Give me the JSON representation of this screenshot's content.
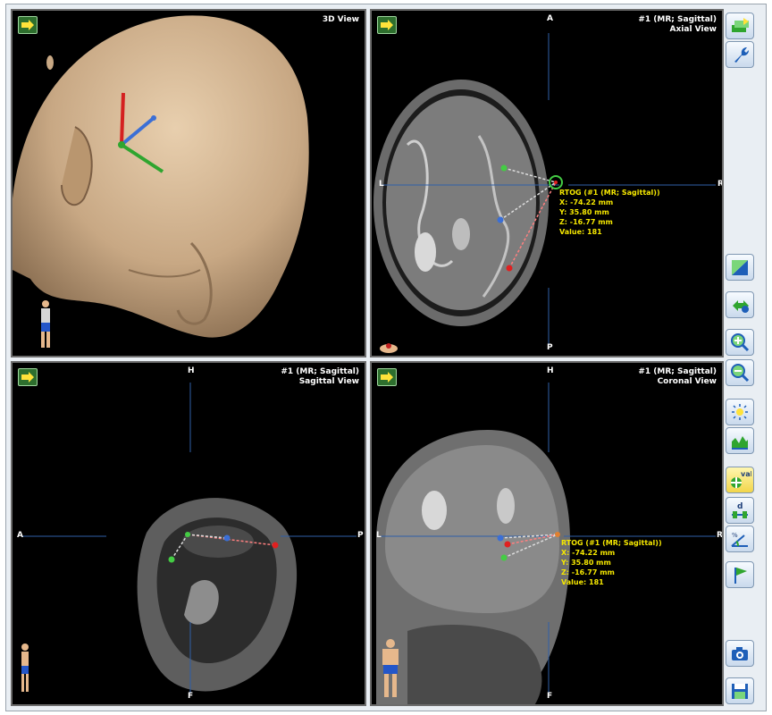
{
  "views": {
    "view3d": {
      "title": "3D View"
    },
    "axial": {
      "series": "#1 (MR; Sagittal)",
      "title": "Axial View",
      "dirs": {
        "top": "A",
        "bottom": "P",
        "left": "L",
        "right": "R"
      }
    },
    "sagittal": {
      "series": "#1 (MR; Sagittal)",
      "title": "Sagittal View",
      "dirs": {
        "top": "H",
        "bottom": "F",
        "left": "A",
        "right": "P"
      }
    },
    "coronal": {
      "series": "#1 (MR; Sagittal)",
      "title": "Coronal View",
      "dirs": {
        "top": "H",
        "bottom": "F",
        "left": "L",
        "right": "R"
      }
    }
  },
  "readout": {
    "name": "RTOG (#1 (MR; Sagittal))",
    "x": "X: -74.22 mm",
    "y": "Y: 35.80 mm",
    "z": "Z: -16.77 mm",
    "value": "Value: 181"
  },
  "toolbar": {
    "icons": [
      "layers-icon",
      "wrench-icon",
      "contrast-icon",
      "pan-icon",
      "zoom-in-icon",
      "zoom-out-icon",
      "brightness-icon",
      "histogram-icon",
      "value-probe-icon",
      "distance-measure-icon",
      "angle-measure-icon",
      "flag-icon",
      "camera-icon",
      "save-icon"
    ],
    "value_probe_label": "val",
    "distance_label": "d"
  },
  "colors": {
    "readout_text": "#f5e700",
    "axis_line": "#2f5fa8",
    "viewport_bg": "#000000",
    "toolbar_bg": "#e9eef3"
  }
}
